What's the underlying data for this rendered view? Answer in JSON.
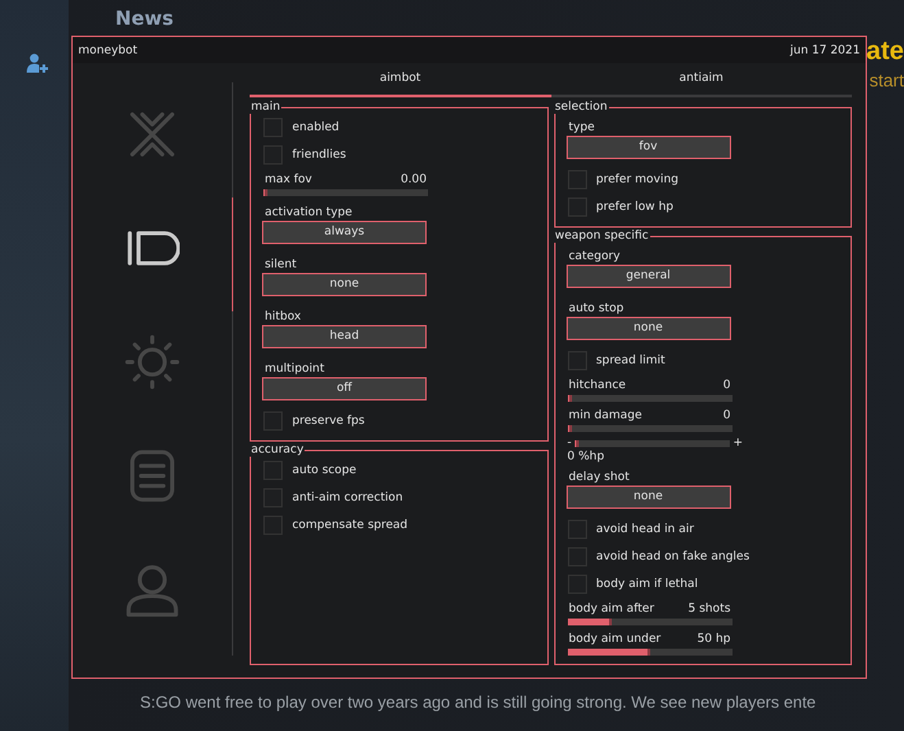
{
  "background": {
    "heading": "News",
    "headline": "ate",
    "subline": "start",
    "paragraph": "S:GO went free to play over two years ago and is still going strong. We see new players ente"
  },
  "window": {
    "title": "moneybot",
    "date": "jun 17 2021"
  },
  "sidebar": [
    {
      "kind": "crosshair",
      "selected": false
    },
    {
      "kind": "id",
      "selected": true
    },
    {
      "kind": "sun",
      "selected": false
    },
    {
      "kind": "list",
      "selected": false
    },
    {
      "kind": "user",
      "selected": false
    }
  ],
  "tabs": [
    {
      "label": "aimbot",
      "selected": true
    },
    {
      "label": "antiaim",
      "selected": false
    }
  ],
  "columns": [
    [
      {
        "title": "main",
        "controls": [
          {
            "kind": "checkbox",
            "label": "enabled",
            "checked": false
          },
          {
            "kind": "checkbox",
            "label": "friendlies",
            "checked": false
          },
          {
            "kind": "slider",
            "label": "max fov",
            "reading": "0.00",
            "level": 0.02
          },
          {
            "kind": "dropdown",
            "label": "activation type",
            "value": "always"
          },
          {
            "kind": "dropdown",
            "label": "silent",
            "value": "none"
          },
          {
            "kind": "dropdown",
            "label": "hitbox",
            "value": "head"
          },
          {
            "kind": "dropdown",
            "label": "multipoint",
            "value": "off"
          },
          {
            "kind": "checkbox",
            "label": "preserve fps",
            "checked": false
          }
        ]
      },
      {
        "title": "accuracy",
        "controls": [
          {
            "kind": "checkbox",
            "label": "auto scope",
            "checked": false
          },
          {
            "kind": "checkbox",
            "label": "anti-aim correction",
            "checked": false
          },
          {
            "kind": "checkbox",
            "label": "compensate spread",
            "checked": false
          }
        ]
      }
    ],
    [
      {
        "title": "selection",
        "controls": [
          {
            "kind": "dropdown",
            "label": "type",
            "value": "fov"
          },
          {
            "kind": "checkbox",
            "label": "prefer moving",
            "checked": false
          },
          {
            "kind": "checkbox",
            "label": "prefer low hp",
            "checked": false
          }
        ]
      },
      {
        "title": "weapon specific",
        "controls": [
          {
            "kind": "dropdown",
            "label": "category",
            "value": "general"
          },
          {
            "kind": "dropdown",
            "label": "auto stop",
            "value": "none"
          },
          {
            "kind": "checkbox",
            "label": "spread limit",
            "checked": false
          },
          {
            "kind": "slider",
            "label": "hitchance",
            "reading": "0",
            "level": 0.02
          },
          {
            "kind": "slider",
            "label": "min damage",
            "reading": "0",
            "level": 0.02
          },
          {
            "kind": "stepper",
            "minus": "-",
            "plus": "+",
            "reading": "0 %hp",
            "level": 0.02
          },
          {
            "kind": "dropdown",
            "label": "delay shot",
            "value": "none"
          },
          {
            "kind": "checkbox",
            "label": "avoid head in air",
            "checked": false
          },
          {
            "kind": "checkbox",
            "label": "avoid head on fake angles",
            "checked": false
          },
          {
            "kind": "checkbox",
            "label": "body aim if lethal",
            "checked": false
          },
          {
            "kind": "slider",
            "label": "body aim after",
            "reading": "5 shots",
            "level": 0.27
          },
          {
            "kind": "slider",
            "label": "body aim under",
            "reading": "50 hp",
            "level": 0.5
          }
        ]
      }
    ]
  ]
}
